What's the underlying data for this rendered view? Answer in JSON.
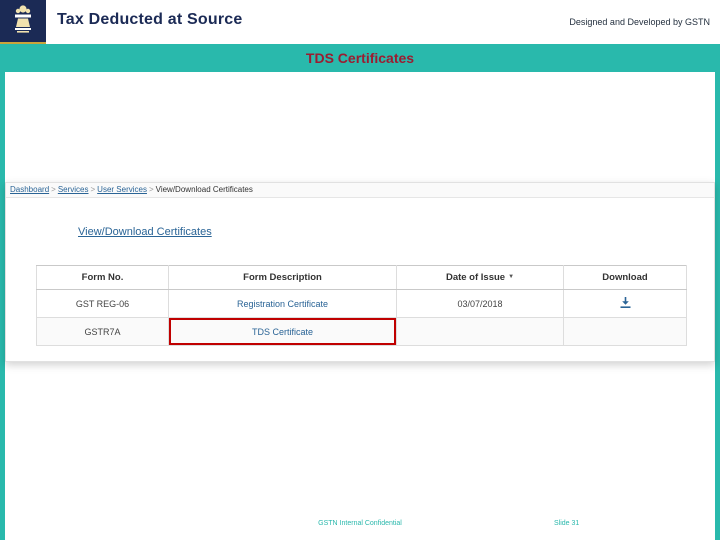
{
  "header": {
    "title": "Tax Deducted at Source",
    "credit": "Designed and Developed by GSTN"
  },
  "banner": {
    "title": "TDS Certificates"
  },
  "portal": {
    "breadcrumb": {
      "separator": ">",
      "items": [
        "Dashboard",
        "Services",
        "User Services",
        "View/Download Certificates"
      ]
    },
    "page_link": "View/Download Certificates",
    "table": {
      "headers": [
        "Form No.",
        "Form Description",
        "Date of Issue",
        "Download"
      ],
      "sort_icon": "▼",
      "rows": [
        {
          "form_no": "GST REG-06",
          "description": "Registration Certificate",
          "date": "03/07/2018",
          "has_download": "yes"
        },
        {
          "form_no": "GSTR7A",
          "description": "TDS Certificate",
          "date": "",
          "has_download": "no"
        }
      ]
    }
  },
  "footer": {
    "center": "GSTN Internal Confidential",
    "right": "Slide 31"
  },
  "colors": {
    "navy": "#1b2a55",
    "teal": "#29b9ac",
    "maroon": "#9b1c31",
    "link_blue": "#2a6496",
    "highlight_red": "#c00000"
  }
}
